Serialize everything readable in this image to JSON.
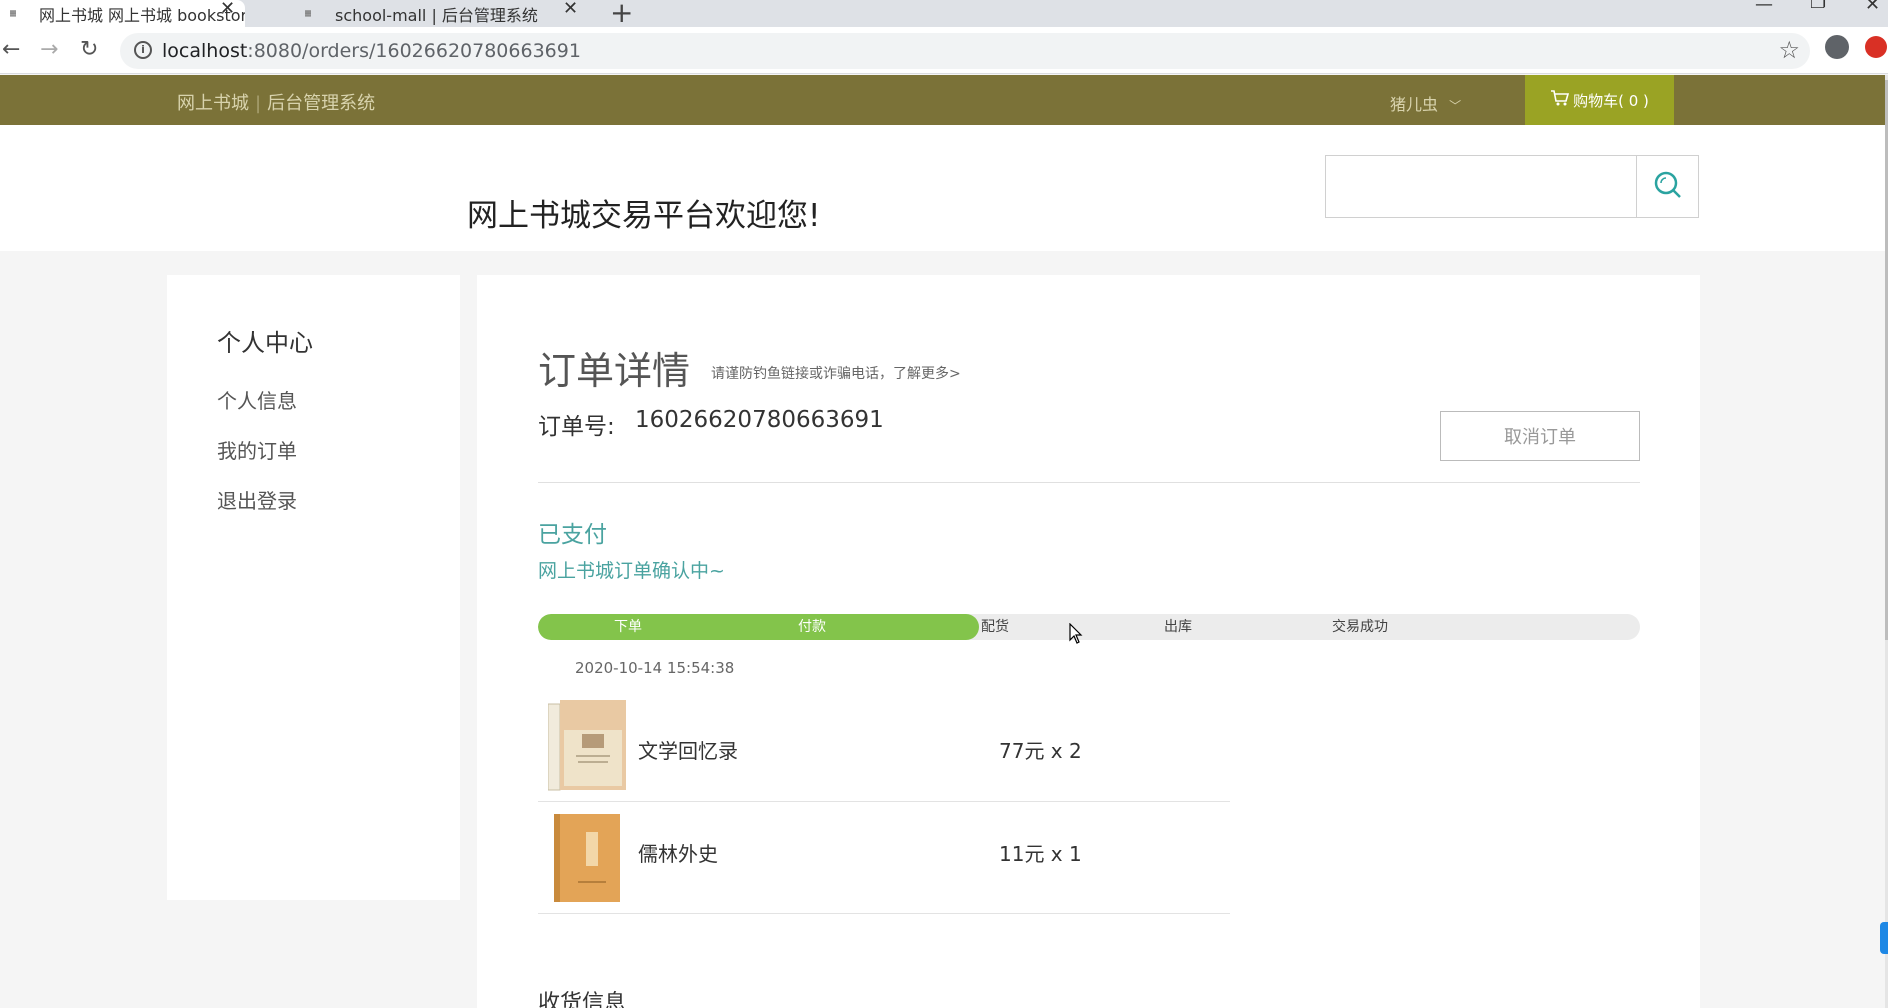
{
  "browser": {
    "tabs": [
      {
        "title": "网上书城 网上书城 bookstore",
        "favicon": "New Bee"
      },
      {
        "title": "school-mall | 后台管理系统",
        "favicon": "New Bee"
      }
    ],
    "url_host": "localhost",
    "url_rest": ":8080/orders/16026620780663691"
  },
  "site": {
    "brand_left": "网上书城",
    "brand_sep": "|",
    "brand_right": "后台管理系统",
    "user_name": "猪儿虫",
    "cart_label": "购物车( 0 )",
    "welcome": "网上书城交易平台欢迎您!"
  },
  "sidebar": {
    "title": "个人中心",
    "items": [
      {
        "label": "个人信息"
      },
      {
        "label": "我的订单"
      },
      {
        "label": "退出登录"
      }
    ]
  },
  "order": {
    "title": "订单详情",
    "tip": "请谨防钓鱼链接或诈骗电话，了解更多>",
    "number_label": "订单号:",
    "number": "16026620780663691",
    "cancel_label": "取消订单",
    "status": "已支付",
    "status_sub": "网上书城订单确认中~",
    "steps": [
      "下单",
      "付款",
      "配货",
      "出库",
      "交易成功"
    ],
    "completed_steps": 2,
    "time": "2020-10-14 15:54:38",
    "items": [
      {
        "name": "文学回忆录",
        "price": "77元 x 2"
      },
      {
        "name": "儒林外史",
        "price": "11元 x 1"
      }
    ],
    "shipping_title": "收货信息"
  },
  "colors": {
    "header_bg": "#7b7238",
    "cart_bg": "#9aa324",
    "accent_teal": "#4aa3a0",
    "progress_green": "#83c44b"
  }
}
